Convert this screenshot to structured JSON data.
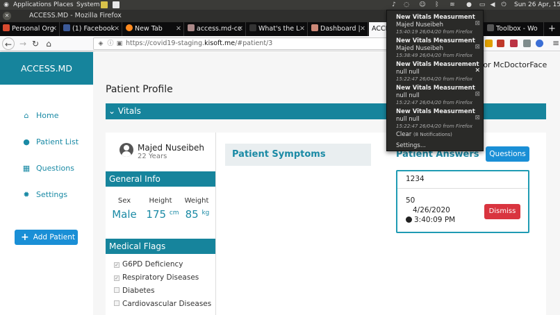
{
  "system_bar": {
    "menus": [
      "Applications",
      "Places",
      "System"
    ],
    "clock": "Sun 26 Apr, 15:4"
  },
  "window": {
    "title": "ACCESS.MD - Mozilla Firefox"
  },
  "tabs": [
    {
      "label": "Personal Org",
      "color": "#d84a2f"
    },
    {
      "label": "(1) Facebook",
      "color": "#3b5998"
    },
    {
      "label": "New Tab",
      "color": "#ff8a1f"
    },
    {
      "label": "access.md-cc",
      "color": "#a88"
    },
    {
      "label": "What's the L",
      "color": "#222"
    },
    {
      "label": "Dashboard |",
      "color": "#c87"
    },
    {
      "label": "ACCE",
      "color": "#16849c"
    },
    {
      "label": "Toolbox - Wo",
      "color": "#555"
    }
  ],
  "address_bar": {
    "url_prefix": "https://covid19-staging.",
    "url_domain": "kisoft.me",
    "url_path": "/#patient/3"
  },
  "app": {
    "brand": "ACCESS.MD",
    "nav": [
      {
        "label": "Home",
        "icon": "home-icon"
      },
      {
        "label": "Patient List",
        "icon": "user-icon"
      },
      {
        "label": "Questions",
        "icon": "calendar-icon"
      },
      {
        "label": "Settings",
        "icon": "gear-icon"
      }
    ],
    "add_patient": "Add Patient",
    "doctor": "tor McDoctorFace"
  },
  "profile": {
    "page_title": "Patient Profile",
    "vitals_header": "Vitals",
    "patient_name": "Majed Nuseibeh",
    "patient_age": "22 Years",
    "general_info_title": "General Info",
    "stats": [
      {
        "label": "Sex",
        "value": "Male",
        "unit": ""
      },
      {
        "label": "Height",
        "value": "175",
        "unit": "cm"
      },
      {
        "label": "Weight",
        "value": "85",
        "unit": "kg"
      }
    ],
    "medical_flags_title": "Medical Flags",
    "flags": [
      {
        "label": "G6PD Deficiency",
        "checked": true
      },
      {
        "label": "Respiratory Diseases",
        "checked": true
      },
      {
        "label": "Diabetes",
        "checked": false
      },
      {
        "label": "Cardiovascular Diseases",
        "checked": false
      }
    ],
    "symptoms_title": "Patient Symptoms",
    "answers_title": "Patient Answers",
    "questions_button": "Questions",
    "answer": {
      "question": "1234",
      "value": "50",
      "date": "4/26/2020",
      "time": "3:40:09 PM",
      "dismiss": "Dismiss"
    }
  },
  "notifications": {
    "items": [
      {
        "title": "New Vitals Measurment",
        "body": "Majed Nuseibeh",
        "meta": "15:40:19 26/04/20 from Firefox"
      },
      {
        "title": "New Vitals Measurment",
        "body": "Majed Nuseibeh",
        "meta": "15:38:49 26/04/20 from Firefox"
      },
      {
        "title": "New Vitals Measurement",
        "body": "null null",
        "meta": "15:22:47 26/04/20 from Firefox"
      },
      {
        "title": "New Vitals Measurment",
        "body": "null null",
        "meta": "15:22:47 26/04/20 from Firefox"
      },
      {
        "title": "New Vitals Measurment",
        "body": "null null",
        "meta": "15:22:47 26/04/20 from Firefox"
      }
    ],
    "clear": "Clear",
    "clear_count": "(8 Notifications)",
    "settings": "Settings..."
  }
}
